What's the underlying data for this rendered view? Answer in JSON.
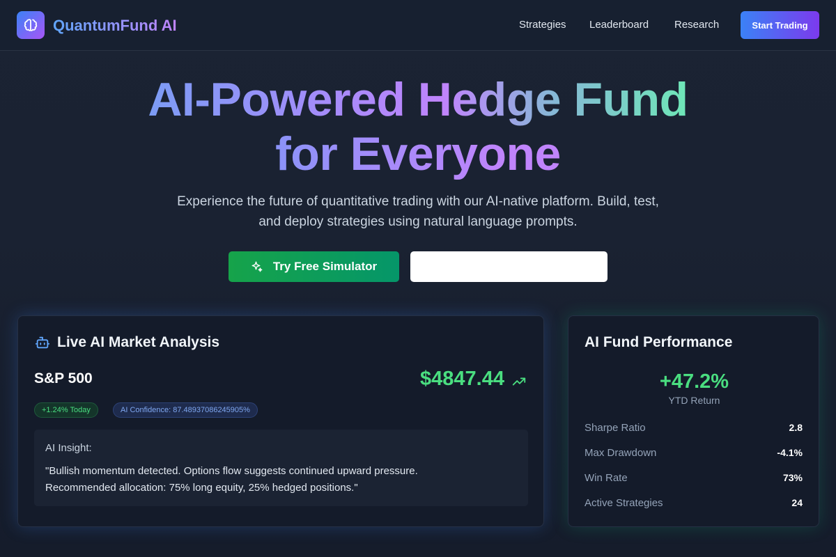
{
  "header": {
    "brand": "QuantumFund AI",
    "nav": [
      "Strategies",
      "Leaderboard",
      "Research"
    ],
    "cta": "Start Trading"
  },
  "hero": {
    "title_line1_part1": "AI-Powered Hedge Fund",
    "title_line2": "for Everyone",
    "subtitle_line1": "Experience the future of quantitative trading with our AI-native platform. Build, test,",
    "subtitle_line2": "and deploy strategies using natural language prompts.",
    "primary_button": "Try Free Simulator",
    "secondary_button": ""
  },
  "analysis": {
    "title": "Live AI Market Analysis",
    "ticker": "S&P 500",
    "price": "$4847.44",
    "change_badge": "+1.24% Today",
    "confidence_badge": "AI Confidence: 87.48937086245905%",
    "insight_label": "AI Insight:",
    "insight_line1": "\"Bullish momentum detected. Options flow suggests continued upward pressure.",
    "insight_line2": "Recommended allocation: 75% long equity, 25% hedged positions.\""
  },
  "performance": {
    "title": "AI Fund Performance",
    "ytd_value": "+47.2%",
    "ytd_label": "YTD Return",
    "stats": [
      {
        "name": "Sharpe Ratio",
        "value": "2.8"
      },
      {
        "name": "Max Drawdown",
        "value": "-4.1%"
      },
      {
        "name": "Win Rate",
        "value": "73%"
      },
      {
        "name": "Active Strategies",
        "value": "24"
      }
    ]
  },
  "colors": {
    "accent_green": "#4ade80",
    "accent_blue": "#3b82f6",
    "accent_purple": "#a855f7"
  },
  "icons": [
    "brain-icon",
    "sparkles-icon",
    "robot-icon",
    "trending-up-icon"
  ]
}
